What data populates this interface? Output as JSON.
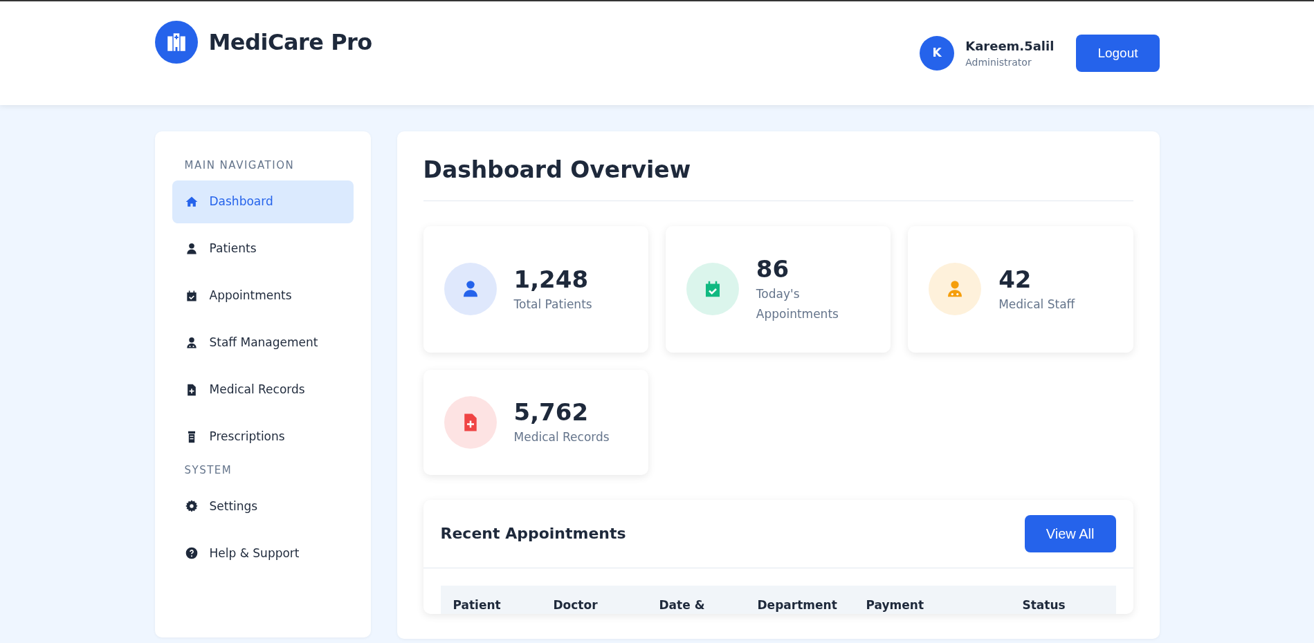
{
  "header": {
    "brand": "MediCare Pro",
    "user": {
      "initial": "K",
      "name": "Kareem.5alil",
      "role": "Administrator"
    },
    "logout": "Logout"
  },
  "sidebar": {
    "sections": [
      {
        "title": "MAIN NAVIGATION",
        "items": [
          {
            "label": "Dashboard",
            "kind": "home",
            "selected": true
          },
          {
            "label": "Patients",
            "kind": "patient",
            "selected": false
          },
          {
            "label": "Appointments",
            "kind": "calendar",
            "selected": false
          },
          {
            "label": "Staff Management",
            "kind": "staff",
            "selected": false
          },
          {
            "label": "Medical Records",
            "kind": "record",
            "selected": false
          },
          {
            "label": "Prescriptions",
            "kind": "jar",
            "selected": false
          }
        ]
      },
      {
        "title": "SYSTEM",
        "items": [
          {
            "label": "Settings",
            "kind": "gear",
            "selected": false
          },
          {
            "label": "Help & Support",
            "kind": "help",
            "selected": false
          }
        ]
      }
    ]
  },
  "main": {
    "title": "Dashboard Overview",
    "stats": [
      {
        "value": "1,248",
        "label": "Total Patients",
        "kind": "patient",
        "color": "#2563eb"
      },
      {
        "value": "86",
        "label": "Today's Appointments",
        "kind": "calendar",
        "color": "#10b981"
      },
      {
        "value": "42",
        "label": "Medical Staff",
        "kind": "staff",
        "color": "#f59e0b"
      },
      {
        "value": "5,762",
        "label": "Medical Records",
        "kind": "record",
        "color": "#ef4444"
      }
    ],
    "recent": {
      "title": "Recent Appointments",
      "button": "View All",
      "columns": [
        "Patient",
        "Doctor",
        "Date &",
        "Department",
        "Payment",
        "Status"
      ]
    }
  }
}
